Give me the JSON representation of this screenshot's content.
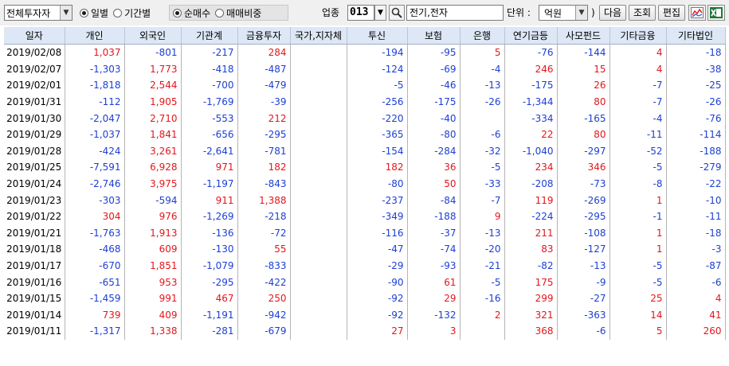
{
  "toolbar": {
    "investor_select": "전체투자자",
    "period_options": [
      "일별",
      "기간별"
    ],
    "period_selected": 0,
    "value_options": [
      "순매수",
      "매매비중"
    ],
    "value_selected": 0,
    "industry_label": "업종",
    "industry_code": "013",
    "industry_name": "전기,전자",
    "unit_label": "단위 :",
    "unit_value": "억원",
    "paren_close": ")",
    "buttons": [
      "다음",
      "조회",
      "편집"
    ]
  },
  "table": {
    "columns": [
      "일자",
      "개인",
      "외국인",
      "기관계",
      "금융투자",
      "국가,지자체",
      "투신",
      "보험",
      "은행",
      "연기금등",
      "사모펀드",
      "기타금융",
      "기타법인"
    ],
    "rows": [
      [
        "2019/02/08",
        "1,037",
        "-801",
        "-217",
        "284",
        "",
        "-194",
        "-95",
        "5",
        "-76",
        "-144",
        "4",
        "-18"
      ],
      [
        "2019/02/07",
        "-1,303",
        "1,773",
        "-418",
        "-487",
        "",
        "-124",
        "-69",
        "-4",
        "246",
        "15",
        "4",
        "-38"
      ],
      [
        "2019/02/01",
        "-1,818",
        "2,544",
        "-700",
        "-479",
        "",
        "-5",
        "-46",
        "-13",
        "-175",
        "26",
        "-7",
        "-25"
      ],
      [
        "2019/01/31",
        "-112",
        "1,905",
        "-1,769",
        "-39",
        "",
        "-256",
        "-175",
        "-26",
        "-1,344",
        "80",
        "-7",
        "-26"
      ],
      [
        "2019/01/30",
        "-2,047",
        "2,710",
        "-553",
        "212",
        "",
        "-220",
        "-40",
        "",
        "-334",
        "-165",
        "-4",
        "-76"
      ],
      [
        "2019/01/29",
        "-1,037",
        "1,841",
        "-656",
        "-295",
        "",
        "-365",
        "-80",
        "-6",
        "22",
        "80",
        "-11",
        "-114"
      ],
      [
        "2019/01/28",
        "-424",
        "3,261",
        "-2,641",
        "-781",
        "",
        "-154",
        "-284",
        "-32",
        "-1,040",
        "-297",
        "-52",
        "-188"
      ],
      [
        "2019/01/25",
        "-7,591",
        "6,928",
        "971",
        "182",
        "",
        "182",
        "36",
        "-5",
        "234",
        "346",
        "-5",
        "-279"
      ],
      [
        "2019/01/24",
        "-2,746",
        "3,975",
        "-1,197",
        "-843",
        "",
        "-80",
        "50",
        "-33",
        "-208",
        "-73",
        "-8",
        "-22"
      ],
      [
        "2019/01/23",
        "-303",
        "-594",
        "911",
        "1,388",
        "",
        "-237",
        "-84",
        "-7",
        "119",
        "-269",
        "1",
        "-10"
      ],
      [
        "2019/01/22",
        "304",
        "976",
        "-1,269",
        "-218",
        "",
        "-349",
        "-188",
        "9",
        "-224",
        "-295",
        "-1",
        "-11"
      ],
      [
        "2019/01/21",
        "-1,763",
        "1,913",
        "-136",
        "-72",
        "",
        "-116",
        "-37",
        "-13",
        "211",
        "-108",
        "1",
        "-18"
      ],
      [
        "2019/01/18",
        "-468",
        "609",
        "-130",
        "55",
        "",
        "-47",
        "-74",
        "-20",
        "83",
        "-127",
        "1",
        "-3"
      ],
      [
        "2019/01/17",
        "-670",
        "1,851",
        "-1,079",
        "-833",
        "",
        "-29",
        "-93",
        "-21",
        "-82",
        "-13",
        "-5",
        "-87"
      ],
      [
        "2019/01/16",
        "-651",
        "953",
        "-295",
        "-422",
        "",
        "-90",
        "61",
        "-5",
        "175",
        "-9",
        "-5",
        "-6"
      ],
      [
        "2019/01/15",
        "-1,459",
        "991",
        "467",
        "250",
        "",
        "-92",
        "29",
        "-16",
        "299",
        "-27",
        "25",
        "4"
      ],
      [
        "2019/01/14",
        "739",
        "409",
        "-1,191",
        "-942",
        "",
        "-92",
        "-132",
        "2",
        "321",
        "-363",
        "14",
        "41"
      ],
      [
        "2019/01/11",
        "-1,317",
        "1,338",
        "-281",
        "-679",
        "",
        "27",
        "3",
        "",
        "368",
        "-6",
        "5",
        "260"
      ]
    ]
  },
  "colors": {
    "positive": "#e4161c",
    "negative": "#1c3fd3",
    "header_bg": "#dde7f5"
  }
}
